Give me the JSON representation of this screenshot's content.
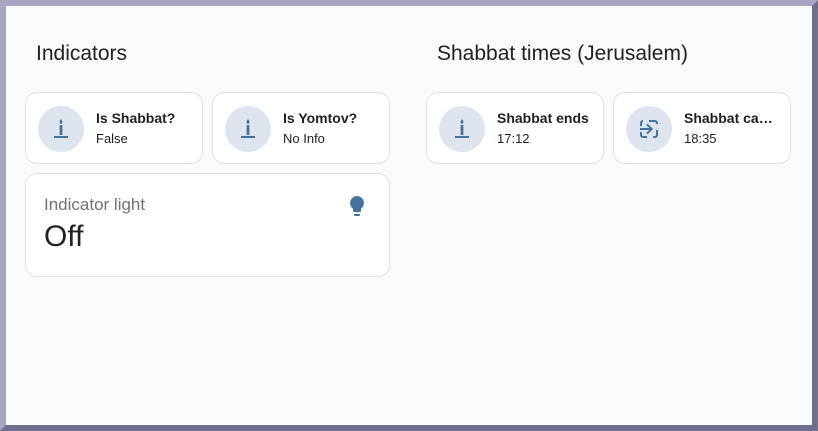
{
  "sections": {
    "indicators_title": "Indicators",
    "times_title": "Shabbat times (Jerusalem)"
  },
  "tiles": [
    {
      "name": "Is Shabbat?",
      "state": "False",
      "icon": "candle-icon"
    },
    {
      "name": "Is Yomtov?",
      "state": "No Info",
      "icon": "candle-icon"
    },
    {
      "name": "Shabbat ends",
      "state": "17:12",
      "icon": "candle-icon"
    },
    {
      "name": "Shabbat candles",
      "state": "18:35",
      "icon": "login-arrow-icon"
    }
  ],
  "indicator_light": {
    "name": "Indicator light",
    "value": "Off",
    "icon": "lightbulb-icon"
  },
  "colors": {
    "accent_icon": "#44739e",
    "icon_bg": "#dde4ee",
    "background": "#fafafa"
  }
}
